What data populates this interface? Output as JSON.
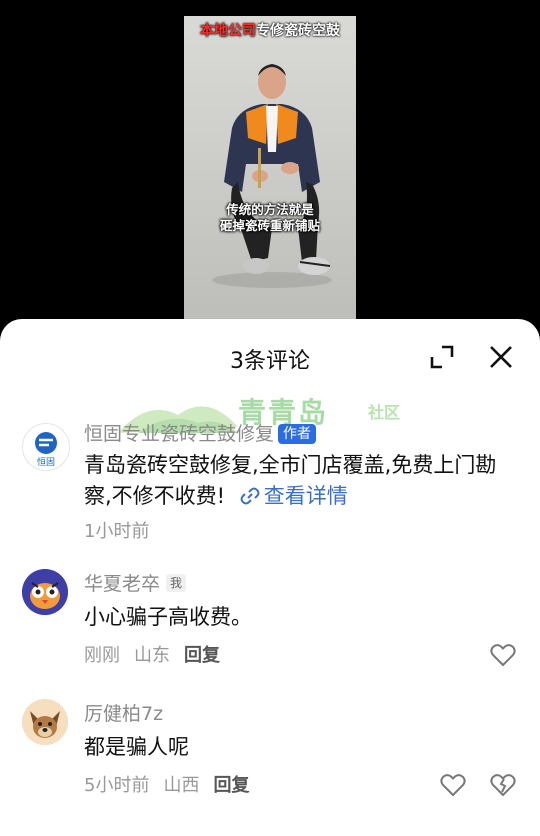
{
  "video": {
    "caption_red": "本地公司",
    "caption_white": "专修瓷砖空鼓",
    "subtitle_line1": "传统的方法就是",
    "subtitle_line2": "砸掉瓷砖重新铺贴"
  },
  "sheet": {
    "title": "3条评论"
  },
  "watermark": {
    "text": "青青岛",
    "suffix": "社区"
  },
  "comments": [
    {
      "name": "恒固专业瓷砖空鼓修复",
      "badge": "作者",
      "avatar_text": "恒固",
      "text": "青岛瓷砖空鼓修复,全市门店覆盖,免费上门勘察,不修不收费!",
      "link": "查看详情",
      "time": "1小时前"
    },
    {
      "name": "华夏老卒",
      "badge": "我",
      "text": "小心骗子高收费。",
      "time": "刚刚",
      "location": "山东",
      "reply": "回复"
    },
    {
      "name": "厉健柏7z",
      "text": "都是骗人呢",
      "time": "5小时前",
      "location": "山西",
      "reply": "回复"
    }
  ],
  "icons": {
    "expand": "expand-icon",
    "close": "close-icon",
    "link": "link-icon",
    "like": "heart-icon",
    "dislike": "broken-heart-icon"
  },
  "colors": {
    "author_badge": "#2b6de0",
    "link": "#3a6fc9"
  }
}
